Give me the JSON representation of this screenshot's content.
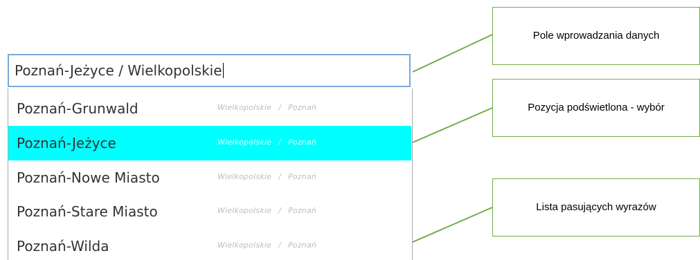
{
  "input": {
    "value": "Poznań-Jeżyce / Wielkopolskie"
  },
  "list": {
    "separator": "/",
    "items": [
      {
        "name": "Poznań-Grunwald",
        "region": "Wielkopolskie",
        "city": "Poznań",
        "highlighted": false
      },
      {
        "name": "Poznań-Jeżyce",
        "region": "Wielkopolskie",
        "city": "Poznań",
        "highlighted": true
      },
      {
        "name": "Poznań-Nowe Miasto",
        "region": "Wielkopolskie",
        "city": "Poznań",
        "highlighted": false
      },
      {
        "name": "Poznań-Stare Miasto",
        "region": "Wielkopolskie",
        "city": "Poznań",
        "highlighted": false
      },
      {
        "name": "Poznań-Wilda",
        "region": "Wielkopolskie",
        "city": "Poznań",
        "highlighted": false
      }
    ]
  },
  "callouts": {
    "input_field": "Pole wprowadzania danych",
    "highlighted_item": "Pozycja podświetlona - wybór",
    "matching_list": "Lista pasujących wyrazów"
  },
  "colors": {
    "highlight": "#00ffff",
    "callout_border": "#70ad47",
    "input_border": "#7aa7d8"
  }
}
